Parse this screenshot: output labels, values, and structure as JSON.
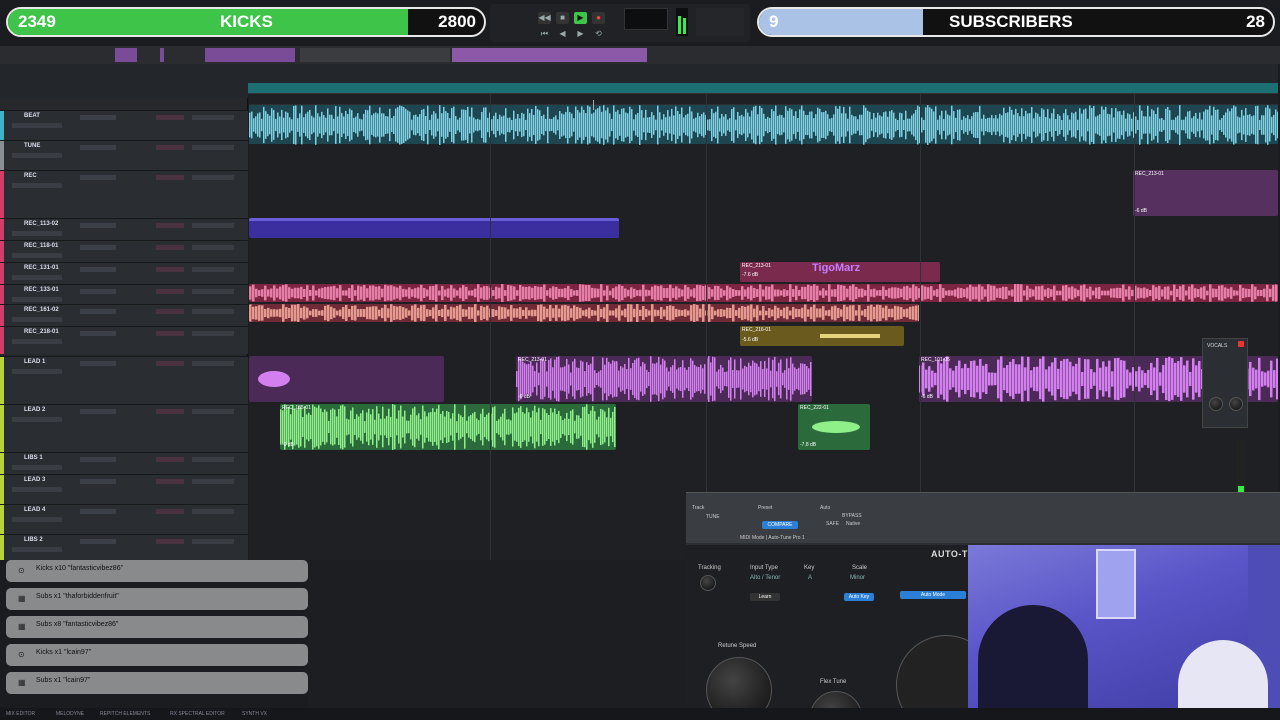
{
  "overlay": {
    "kicks_count": "2349",
    "kicks_label": "KICKS",
    "kicks_goal": "2800",
    "kicks_progress": 0.84,
    "subs_count": "9",
    "subs_label": "SUBSCRIBERS",
    "subs_goal": "28",
    "subs_progress": 0.32
  },
  "tracks": [
    {
      "name": "BEAT",
      "color": "#3fb2c8"
    },
    {
      "name": "TUNE",
      "color": "#8a8f95"
    },
    {
      "name": "REC",
      "color": "#d43c6a"
    },
    {
      "name": "REC_113-02",
      "color": "#d43c6a"
    },
    {
      "name": "REC_118-01",
      "color": "#d43c6a"
    },
    {
      "name": "REC_131-01",
      "color": "#d43c6a"
    },
    {
      "name": "REC_133-01",
      "color": "#d43c6a"
    },
    {
      "name": "REC_161-02",
      "color": "#d43c6a"
    },
    {
      "name": "REC_218-01",
      "color": "#d43c6a"
    },
    {
      "name": "LEAD 1",
      "color": "#b7d23a"
    },
    {
      "name": "LEAD 2",
      "color": "#b7d23a"
    },
    {
      "name": "LIBS 1",
      "color": "#b7d23a"
    },
    {
      "name": "LEAD 3",
      "color": "#b7d23a"
    },
    {
      "name": "LEAD 4",
      "color": "#b7d23a"
    },
    {
      "name": "LIBS 2",
      "color": "#b7d23a"
    }
  ],
  "clips": [
    {
      "label": "REC_213-01",
      "vol": "-6 dB"
    },
    {
      "label": "REC_213-01",
      "vol": "-7.6 dB"
    },
    {
      "label": "REC_216-01",
      "vol": "-5.6 dB"
    },
    {
      "label": "REC_213-01",
      "vol": "-6 dB"
    },
    {
      "label": "REC_101-05",
      "vol": "-6 dB"
    },
    {
      "label": "REC_185-01",
      "vol": "-6 dB"
    },
    {
      "label": "REC_222-01",
      "vol": "-7.8 dB"
    }
  ],
  "chat_tag": "TigoMarz",
  "alerts": [
    {
      "text": "Kicks x10 \"fantasticvibez86\""
    },
    {
      "text": "Subs x1 \"thaforbiddenfruit\""
    },
    {
      "text": "Subs x8 \"fantasticvibez86\""
    },
    {
      "text": "Kicks x1 \"lcain97\""
    },
    {
      "text": "Subs x1 \"lcain97\""
    }
  ],
  "plugin": {
    "title": "AUTO-TUNE",
    "track_lbl": "Track",
    "preset_lbl": "Preset",
    "auto_lbl": "Auto",
    "bypass_lbl": "BYPASS",
    "safe_lbl": "SAFE",
    "native_lbl": "Native",
    "compare_lbl": "COMPARE",
    "tracking_lbl": "Tracking",
    "input_type_lbl": "Input Type",
    "input_type_val": "Alto / Tenor",
    "key_lbl": "Key",
    "key_val": "A",
    "scale_lbl": "Scale",
    "scale_val": "Minor",
    "learn_lbl": "Learn",
    "autokey_lbl": "Auto Key",
    "mode_lbl": "Auto Mode",
    "retune_lbl": "Retune Speed",
    "flex_lbl": "Flex Tune",
    "track_val": "TUNE",
    "midi_lbl": "MIDI Mode | Auto-Tune Pro 1"
  },
  "vocal_panel_lbl": "VOCALS",
  "status": [
    "MIX EDITOR",
    "MELODYNE",
    "REPITCH ELEMENTS",
    "RX SPECTRAL EDITOR",
    "SYNTH VX"
  ],
  "colors": {
    "kicks_fill": "#3ec449",
    "subs_fill": "#a9c2e6",
    "accent_plugin": "#2c7fd6"
  }
}
